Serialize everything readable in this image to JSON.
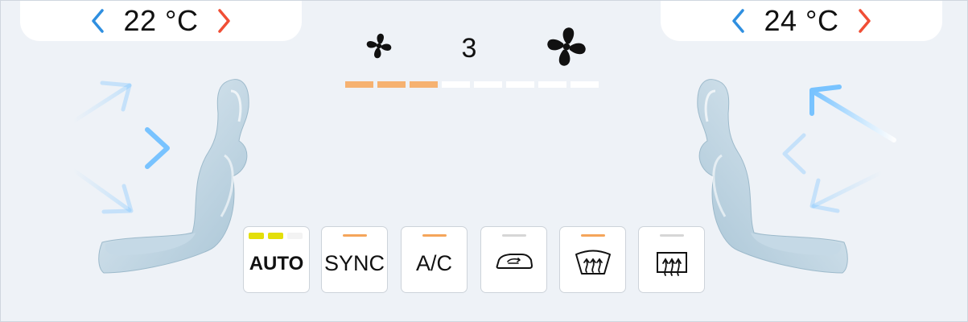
{
  "left_zone": {
    "temperature": "22 °C"
  },
  "right_zone": {
    "temperature": "24 °C"
  },
  "fan": {
    "speed": "3",
    "level": 3,
    "levels_total": 8
  },
  "controls": [
    {
      "id": "auto",
      "label": "AUTO",
      "indicator_colors": [
        "#e3df0a",
        "#e3df0a",
        "#f3f3f3"
      ]
    },
    {
      "id": "sync",
      "label": "SYNC",
      "indicator": "#f5a55a"
    },
    {
      "id": "ac",
      "label": "A/C",
      "indicator": "#f5a55a"
    },
    {
      "id": "recirculation",
      "icon": "car-recirculation-icon",
      "indicator": "#d6d6d6"
    },
    {
      "id": "front-defrost",
      "icon": "front-defrost-icon",
      "indicator": "#f5a55a"
    },
    {
      "id": "rear-defrost",
      "icon": "rear-defrost-icon",
      "indicator": "#d6d6d6"
    }
  ],
  "colors": {
    "chevron_down": "#2f8fe0",
    "chevron_up": "#f04e35",
    "fan_active": "#f6b271",
    "airflow": "#78c3ff",
    "background": "#eef2f7"
  }
}
